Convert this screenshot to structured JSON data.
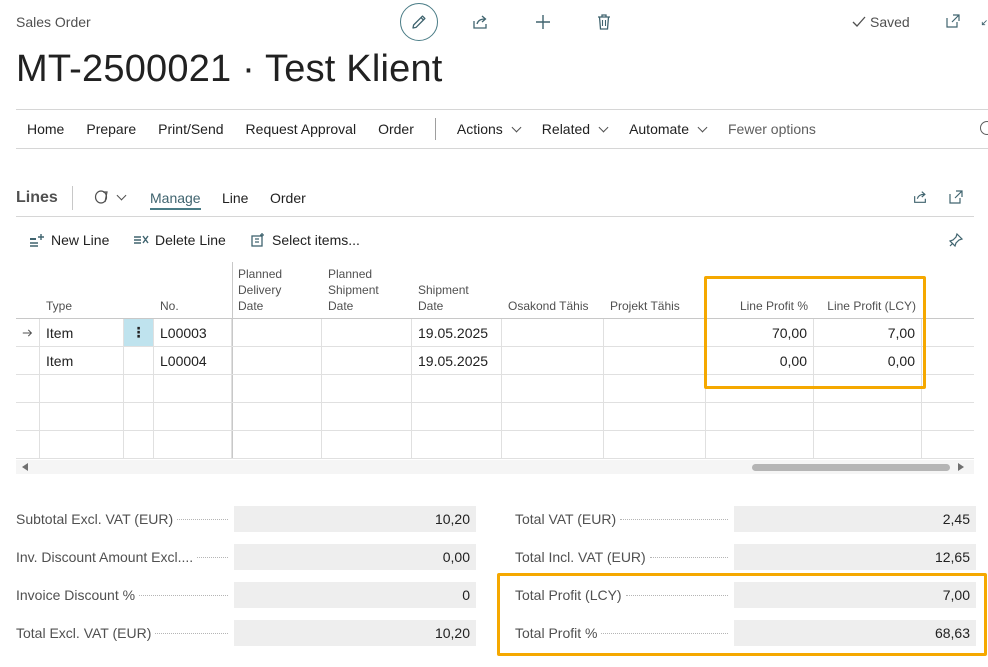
{
  "header": {
    "doc_type": "Sales Order",
    "saved_label": "Saved",
    "title": "MT-2500021 · Test Klient"
  },
  "actionbar": {
    "items": [
      "Home",
      "Prepare",
      "Print/Send",
      "Request Approval",
      "Order"
    ],
    "menus": [
      "Actions",
      "Related",
      "Automate"
    ],
    "fewer_options": "Fewer options"
  },
  "lines": {
    "title": "Lines",
    "tabs": [
      "Manage",
      "Line",
      "Order"
    ],
    "toolbar": {
      "new_line": "New Line",
      "delete_line": "Delete Line",
      "select_items": "Select items..."
    },
    "columns": {
      "type": "Type",
      "no": "No.",
      "planned_delivery": [
        "Planned",
        "Delivery",
        "Date"
      ],
      "planned_shipment": [
        "Planned",
        "Shipment",
        "Date"
      ],
      "shipment_date": [
        "Shipment",
        "Date"
      ],
      "osakond": "Osakond Tähis",
      "projekt": "Projekt Tähis",
      "line_profit_pct": "Line Profit %",
      "line_profit_lcy": "Line Profit (LCY)"
    },
    "rows": [
      {
        "type": "Item",
        "no": "L00003",
        "shipment_date": "19.05.2025",
        "line_profit_pct": "70,00",
        "line_profit_lcy": "7,00"
      },
      {
        "type": "Item",
        "no": "L00004",
        "shipment_date": "19.05.2025",
        "line_profit_pct": "0,00",
        "line_profit_lcy": "0,00"
      }
    ]
  },
  "totals": {
    "left": [
      {
        "label": "Subtotal Excl. VAT (EUR)",
        "value": "10,20"
      },
      {
        "label": "Inv. Discount Amount Excl....",
        "value": "0,00"
      },
      {
        "label": "Invoice Discount %",
        "value": "0"
      },
      {
        "label": "Total Excl. VAT (EUR)",
        "value": "10,20"
      }
    ],
    "right": [
      {
        "label": "Total VAT (EUR)",
        "value": "2,45"
      },
      {
        "label": "Total Incl. VAT (EUR)",
        "value": "12,65"
      },
      {
        "label": "Total Profit (LCY)",
        "value": "7,00"
      },
      {
        "label": "Total Profit %",
        "value": "68,63"
      }
    ]
  },
  "colors": {
    "accent": "#4a7c86",
    "highlight": "#f5a800",
    "selected_cell": "#bfe3ee"
  }
}
